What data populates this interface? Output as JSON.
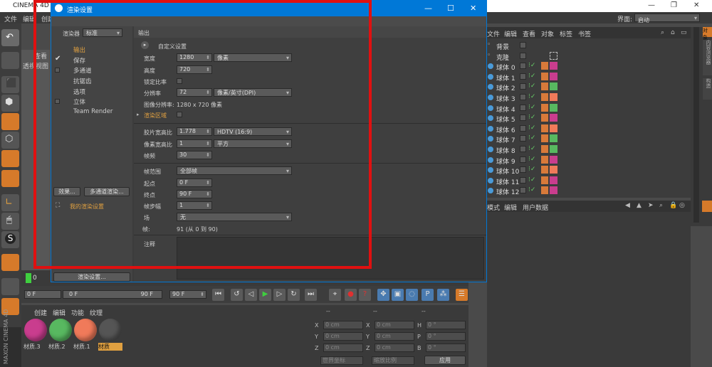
{
  "app": {
    "title": "CINEMA 4D",
    "layout_label": "界面:",
    "layout_value": "启动"
  },
  "menu": [
    "文件",
    "编辑",
    "创建"
  ],
  "om": {
    "menu": [
      "文件",
      "编辑",
      "查看",
      "对象",
      "标签",
      "书签"
    ],
    "objects": [
      "背景",
      "克隆",
      "球体 0",
      "球体 1",
      "球体 2",
      "球体 3",
      "球体 4",
      "球体 5",
      "球体 6",
      "球体 7",
      "球体 8",
      "球体 9",
      "球体 10",
      "球体 11",
      "球体 12"
    ],
    "tag_colors": [
      "#c93d8e",
      "#c93d8e",
      "#58b860",
      "#f07a5a",
      "#58b860",
      "#c93d8e",
      "#f07a5a",
      "#58b860",
      "#58b860",
      "#c93d8e",
      "#f07a5a",
      "#c93d8e",
      "#c93d8e"
    ]
  },
  "attr": {
    "menu": [
      "模式",
      "编辑",
      "用户数据"
    ]
  },
  "side_tabs": [
    "对象",
    "内容浏览器",
    "构造"
  ],
  "viewport": {
    "tabs": [
      "查看",
      "透视视图"
    ]
  },
  "dialog": {
    "title": "渲染设置",
    "renderer_label": "渲染器",
    "renderer_value": "标准",
    "nav": [
      "输出",
      "保存",
      "多通道",
      "抗锯齿",
      "选项",
      "立体",
      "Team Render"
    ],
    "btn_effects": "效果...",
    "btn_multipass": "多通道渲染...",
    "my_setting": "我的渲染设置",
    "btn_render_settings": "渲染设置...",
    "section": "输出",
    "custom": "自定义设置",
    "width_label": "宽度",
    "width": "1280",
    "unit": "像素",
    "height_label": "高度",
    "height": "720",
    "lock_label": "锁定比率",
    "res_label": "分辨率",
    "res": "72",
    "res_unit": "像素/英寸(DPI)",
    "imgres_label": "图像分辨率:",
    "imgres": "1280 x 720 像素",
    "region_label": "渲染区域",
    "film_label": "胶片宽高比",
    "film": "1.778",
    "film_preset": "HDTV (16:9)",
    "pixel_label": "像素宽高比",
    "pixel": "1",
    "pixel_preset": "平方",
    "fps_label": "帧频",
    "fps": "30",
    "range_label": "帧范围",
    "range": "全部帧",
    "start_label": "起点",
    "start": "0 F",
    "end_label": "终点",
    "end": "90 F",
    "step_label": "帧步幅",
    "step": "1",
    "field_label": "场",
    "field": "无",
    "frames_label": "帧:",
    "frames": "91 (从 0 到 90)",
    "notes_label": "注释"
  },
  "timeline": {
    "current": "0 F",
    "range_start": "0 F",
    "range_end": "90 F",
    "end": "90 F",
    "tick_0": "0"
  },
  "materials": {
    "menu": [
      "创建",
      "编辑",
      "功能",
      "纹理"
    ],
    "items": [
      {
        "name": "材质.3",
        "color": "#c93d8e"
      },
      {
        "name": "材质.2",
        "color": "#58b860"
      },
      {
        "name": "材质.1",
        "color": "#f07a5a"
      },
      {
        "name": "材质",
        "color": "#555555"
      }
    ]
  },
  "coords": {
    "headers": [
      "--",
      "--",
      "--"
    ],
    "rows": [
      {
        "a": "X",
        "av": "0 cm",
        "b": "X",
        "bv": "0 cm",
        "c": "H",
        "cv": "0 °"
      },
      {
        "a": "Y",
        "av": "0 cm",
        "b": "Y",
        "bv": "0 cm",
        "c": "P",
        "cv": "0 °"
      },
      {
        "a": "Z",
        "av": "0 cm",
        "b": "Z",
        "bv": "0 cm",
        "c": "B",
        "cv": "0 °"
      }
    ],
    "world": "世界坐标",
    "scale": "缩放比例",
    "apply": "应用"
  },
  "brand": "MAXON CINEMA 4D",
  "highlight_color": "#e01010"
}
